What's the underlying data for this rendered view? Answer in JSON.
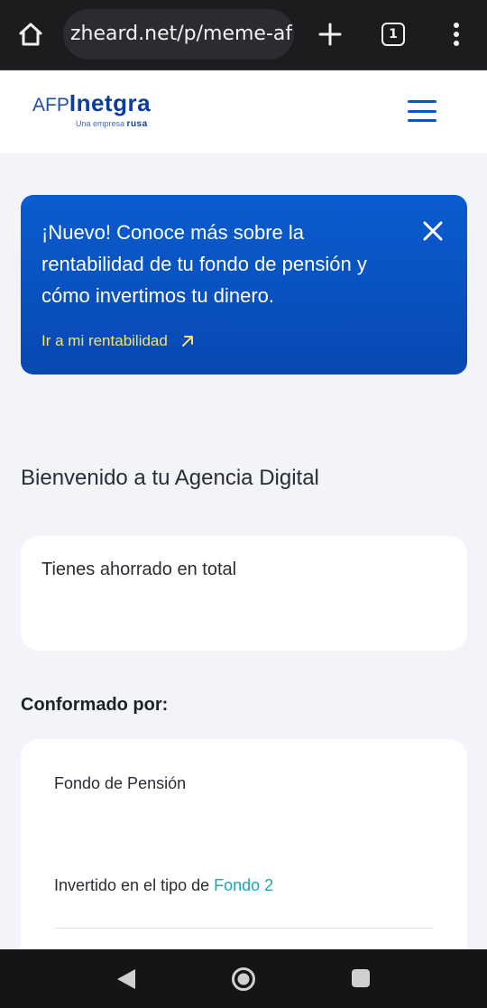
{
  "browser": {
    "url": "zheard.net/p/meme-afp",
    "tab_count": "1",
    "icons": {
      "home": "home-icon",
      "new_tab": "plus-icon",
      "tabs": "tabs-icon",
      "menu": "more-vert-icon"
    }
  },
  "header": {
    "logo_prefix": "AFP",
    "logo_brand": "Inetgra",
    "logo_tagline": "Una empresa",
    "logo_tagline_brand": "rusa",
    "menu_icon": "hamburger-icon"
  },
  "banner": {
    "text": "¡Nuevo! Conoce más sobre la rentabilidad de tu fondo de pensión y cómo invertimos tu dinero.",
    "link_label": "Ir a mi rentabilidad",
    "colors": {
      "background": "#0a5cd0",
      "link": "#f7e26a"
    }
  },
  "main": {
    "welcome": "Bienvenido a tu Agencia Digital",
    "total_label": "Tienes ahorrado en total",
    "section_title": "Conformado por:",
    "fund": {
      "name": "Fondo de Pensión",
      "type_prefix": "Invertido en el tipo de",
      "type_value": "Fondo 2",
      "accent": "#1aa6b4"
    }
  },
  "system_nav": {
    "icons": [
      "back-icon",
      "home-circle-icon",
      "recents-icon"
    ]
  }
}
